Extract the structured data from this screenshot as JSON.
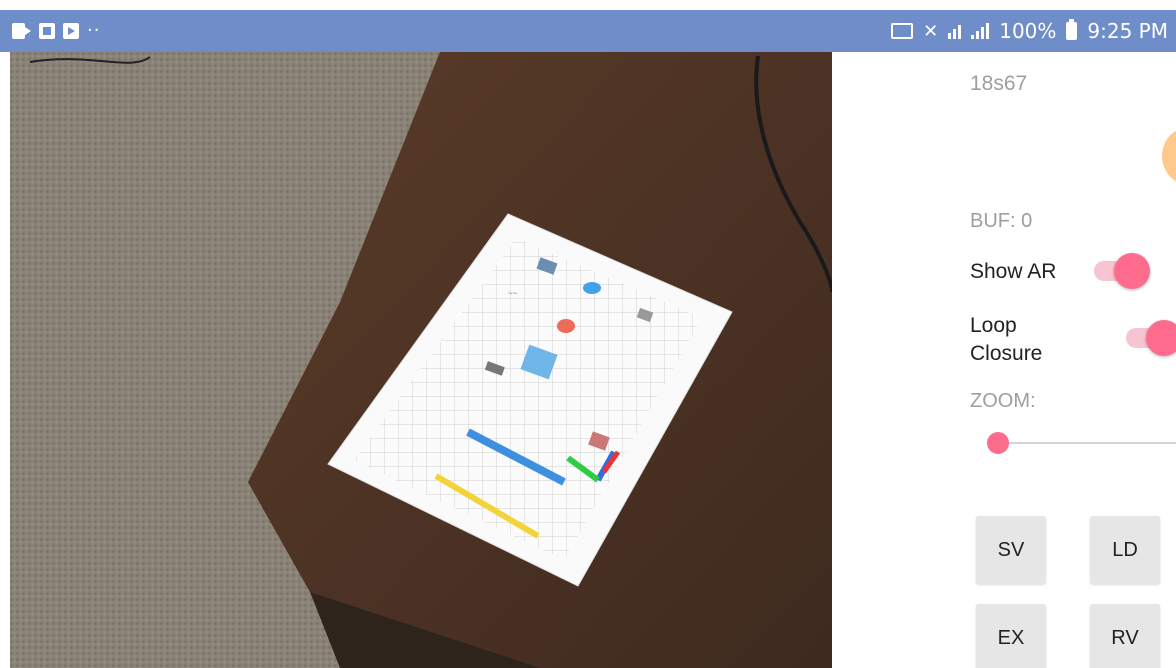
{
  "status_bar": {
    "battery": "100%",
    "time": "9:25 PM",
    "icons": [
      "camera-icon",
      "gallery-icon",
      "video-icon",
      "more-dots-icon",
      "cast-icon",
      "mute-icon",
      "wifi-icon",
      "signal-icon",
      "battery-icon"
    ]
  },
  "camera_view": {
    "description_icon": "ar-camera-feed"
  },
  "panel": {
    "id_label": "18s67",
    "buffer_label": "BUF: 0",
    "show_ar": {
      "label": "Show AR",
      "on": true
    },
    "loop_closure": {
      "label_line1": "Loop",
      "label_line2": "Closure",
      "on": true
    },
    "zoom_label": "ZOOM:",
    "zoom_value": 0,
    "buttons": {
      "sv": "SV",
      "ld": "LD",
      "ex": "EX",
      "rv": "RV"
    }
  },
  "colors": {
    "status_bar": "#6f8ec9",
    "accent": "#ff6b8c",
    "fab": "#ffc98b"
  }
}
